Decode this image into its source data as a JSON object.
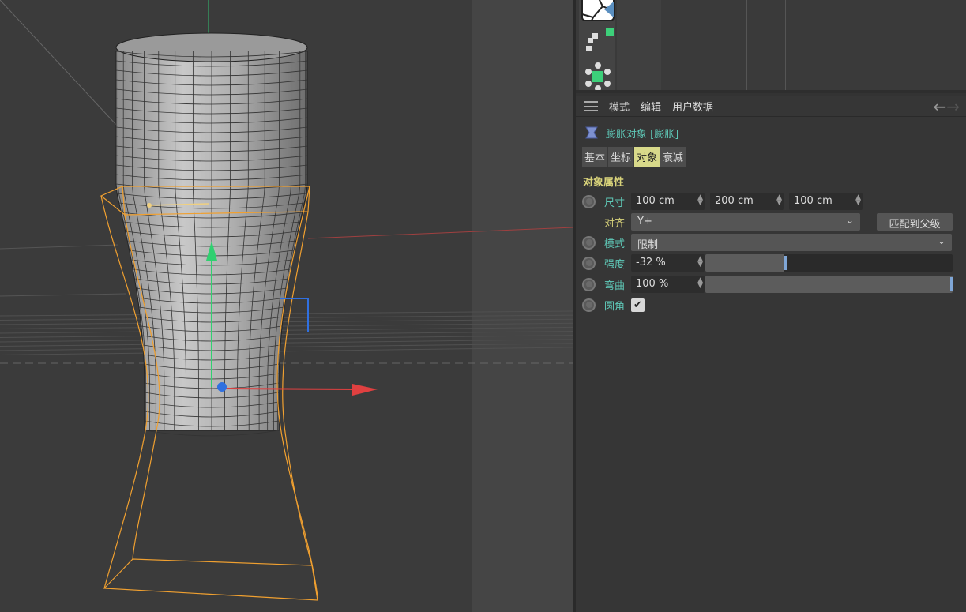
{
  "menu": {
    "items": [
      "模式",
      "编辑",
      "用户数据"
    ],
    "back": "←",
    "forward": "→"
  },
  "object": {
    "title": "膨胀对象 [膨胀]",
    "icon": "bulge-deformer-icon"
  },
  "tabs": [
    {
      "label": "基本"
    },
    {
      "label": "坐标"
    },
    {
      "label": "对象",
      "active": true
    },
    {
      "label": "衰减"
    }
  ],
  "section": "对象属性",
  "props": {
    "size": {
      "label": "尺寸",
      "x": "100 cm",
      "y": "200 cm",
      "z": "100 cm"
    },
    "align": {
      "label": "对齐",
      "value": "Y+",
      "button": "匹配到父级"
    },
    "mode": {
      "label": "模式",
      "value": "限制"
    },
    "strength": {
      "label": "强度",
      "value": "-32 %",
      "fraction": 0.32
    },
    "curvature": {
      "label": "弯曲",
      "value": "100 %",
      "fraction": 1.0
    },
    "fillet": {
      "label": "圆角",
      "checked": true,
      "mark": "✔"
    }
  },
  "colors": {
    "accent_teal": "#5fc9b8",
    "section_yellow": "#d8d27a",
    "cage_orange": "#f0a030",
    "axis_x": "#e04040",
    "axis_y": "#30d070",
    "axis_z": "#3070e0"
  }
}
